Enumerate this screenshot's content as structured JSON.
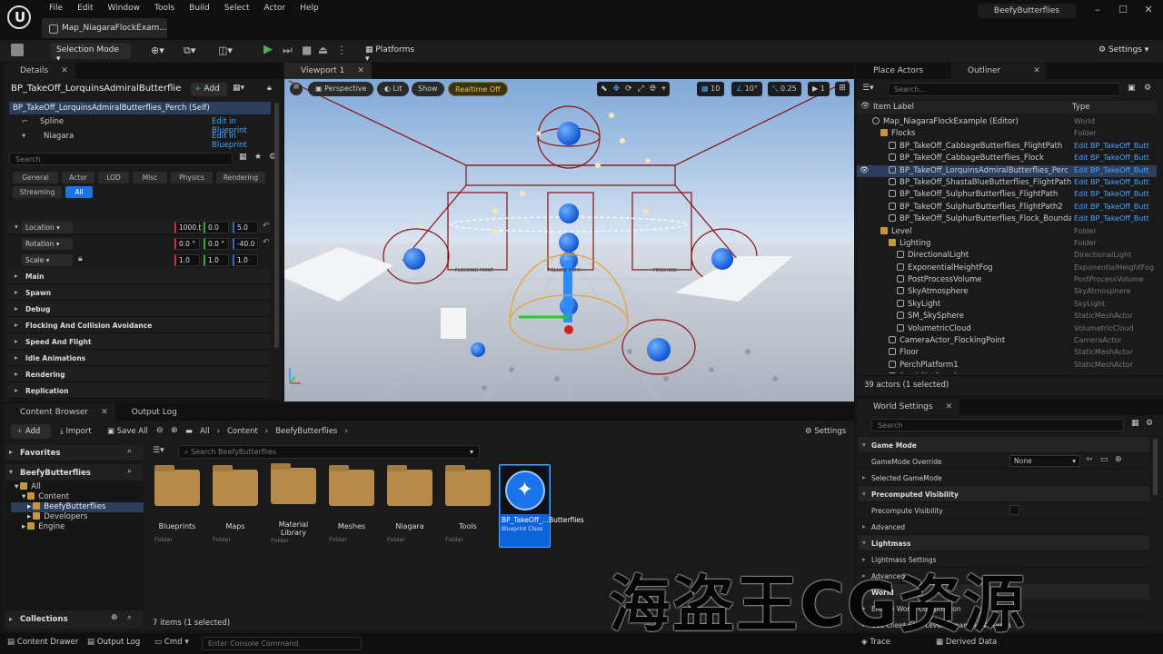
{
  "menubar": {
    "items": [
      "File",
      "Edit",
      "Window",
      "Tools",
      "Build",
      "Select",
      "Actor",
      "Help"
    ],
    "doc_tab": "Map_NiagaraFlockExam...",
    "project": "BeefyButterflies"
  },
  "toolbar": {
    "mode": "Selection Mode",
    "platforms": "Platforms",
    "settings": "Settings"
  },
  "details": {
    "tab": "Details",
    "actor_name": "BP_TakeOff_LorquinsAdmiralButterflie",
    "add": "Add",
    "components": [
      {
        "label": "BP_TakeOff_LorquinsAdmiralButterflies_Perch (Self)",
        "link": ""
      },
      {
        "label": "Spline",
        "link": "Edit in Blueprint"
      },
      {
        "label": "Niagara",
        "link": "Edit in Blueprint"
      }
    ],
    "search_placeholder": "Search",
    "categories": [
      "General",
      "Actor",
      "LOD",
      "Misc",
      "Physics",
      "Rendering",
      "Streaming",
      "All"
    ],
    "transform": {
      "title": "Transform",
      "rows": [
        {
          "label": "Location",
          "v": [
            "1000.t",
            "0.0",
            "5.0"
          ]
        },
        {
          "label": "Rotation",
          "v": [
            "0.0 °",
            "0.0 °",
            "-40.0"
          ]
        },
        {
          "label": "Scale",
          "v": [
            "1.0",
            "1.0",
            "1.0"
          ]
        }
      ]
    },
    "sections": [
      "Main",
      "Spawn",
      "Debug",
      "Flocking And Collision Avoidance",
      "Speed And Flight",
      "Idle Animations",
      "Rendering",
      "Replication"
    ]
  },
  "viewport": {
    "tab": "Viewport 1",
    "perspective": "Perspective",
    "lit": "Lit",
    "show": "Show",
    "realtime": "Realtime Off",
    "grid": "10",
    "angle": "10°",
    "scale": "0.25",
    "cam": "1",
    "labels": [
      "FLOCKING POINT",
      "FOLLOW PATH",
      "PERCHING"
    ]
  },
  "outliner": {
    "tabs": [
      "Place Actors",
      "Outliner"
    ],
    "search_placeholder": "Search...",
    "col_label": "Item Label",
    "col_type": "Type",
    "rows": [
      {
        "label": "Map_NiagaraFlockExample (Editor)",
        "type": "World",
        "indent": 1,
        "icon": "world",
        "link": false
      },
      {
        "label": "Flocks",
        "type": "Folder",
        "indent": 2,
        "icon": "folder",
        "link": false
      },
      {
        "label": "BP_TakeOff_CabbageButterflies_FlightPath",
        "type": "Edit BP_TakeOff_Butt",
        "indent": 3,
        "icon": "actor",
        "link": true
      },
      {
        "label": "BP_TakeOff_CabbageButterflies_Flock",
        "type": "Edit BP_TakeOff_Butt",
        "indent": 3,
        "icon": "actor",
        "link": true
      },
      {
        "label": "BP_TakeOff_LorquinsAdmiralButterflies_Perc",
        "type": "Edit BP_TakeOff_Butt",
        "indent": 3,
        "icon": "actor",
        "link": true,
        "selected": true
      },
      {
        "label": "BP_TakeOff_ShastaBlueButterflies_FlightPath",
        "type": "Edit BP_TakeOff_Butt",
        "indent": 3,
        "icon": "actor",
        "link": true
      },
      {
        "label": "BP_TakeOff_SulphurButterflies_FlightPath",
        "type": "Edit BP_TakeOff_Butt",
        "indent": 3,
        "icon": "actor",
        "link": true
      },
      {
        "label": "BP_TakeOff_SulphurButterflies_FlightPath2",
        "type": "Edit BP_TakeOff_Butt",
        "indent": 3,
        "icon": "actor",
        "link": true
      },
      {
        "label": "BP_TakeOff_SulphurButterflies_Flock_Bounda",
        "type": "Edit BP_TakeOff_Butt",
        "indent": 3,
        "icon": "actor",
        "link": true
      },
      {
        "label": "Level",
        "type": "Folder",
        "indent": 2,
        "icon": "folder",
        "link": false
      },
      {
        "label": "Lighting",
        "type": "Folder",
        "indent": 3,
        "icon": "folder",
        "link": false
      },
      {
        "label": "DirectionalLight",
        "type": "DirectionalLight",
        "indent": 4,
        "icon": "actor",
        "link": false
      },
      {
        "label": "ExponentialHeightFog",
        "type": "ExponentialHeightFog",
        "indent": 4,
        "icon": "actor",
        "link": false
      },
      {
        "label": "PostProcessVolume",
        "type": "PostProcessVolume",
        "indent": 4,
        "icon": "actor",
        "link": false
      },
      {
        "label": "SkyAtmosphere",
        "type": "SkyAtmosphere",
        "indent": 4,
        "icon": "actor",
        "link": false
      },
      {
        "label": "SkyLight",
        "type": "SkyLight",
        "indent": 4,
        "icon": "actor",
        "link": false
      },
      {
        "label": "SM_SkySphere",
        "type": "StaticMeshActor",
        "indent": 4,
        "icon": "actor",
        "link": false
      },
      {
        "label": "VolumetricCloud",
        "type": "VolumetricCloud",
        "indent": 4,
        "icon": "actor",
        "link": false
      },
      {
        "label": "CameraActor_FlockingPoint",
        "type": "CameraActor",
        "indent": 3,
        "icon": "actor",
        "link": false
      },
      {
        "label": "Floor",
        "type": "StaticMeshActor",
        "indent": 3,
        "icon": "actor",
        "link": false
      },
      {
        "label": "PerchPlatform1",
        "type": "StaticMeshActor",
        "indent": 3,
        "icon": "actor",
        "link": false
      },
      {
        "label": "PerchPlatform2",
        "type": "StaticMeshActor",
        "indent": 3,
        "icon": "actor",
        "link": false
      }
    ],
    "status": "39 actors (1 selected)"
  },
  "content": {
    "tabs": [
      "Content Browser",
      "Output Log"
    ],
    "add": "Add",
    "import": "Import",
    "save_all": "Save All",
    "breadcrumb": [
      "All",
      "Content",
      "BeefyButterflies"
    ],
    "settings": "Settings",
    "favorites": "Favorites",
    "project": "BeefyButterflies",
    "tree": [
      "All",
      "Content",
      "BeefyButterflies",
      "Developers",
      "Engine"
    ],
    "search_placeholder": "Search BeefyButterflies",
    "collections": "Collections",
    "assets": [
      {
        "name": "Blueprints",
        "sub": "Folder"
      },
      {
        "name": "Maps",
        "sub": "Folder"
      },
      {
        "name": "Material Library",
        "sub": "Folder"
      },
      {
        "name": "Meshes",
        "sub": "Folder"
      },
      {
        "name": "Niagara",
        "sub": "Folder"
      },
      {
        "name": "Tools",
        "sub": "Folder"
      }
    ],
    "selected_asset": {
      "name": "BP_TakeOff_...Butterflies",
      "sub": "Blueprint Class"
    },
    "count": "7 items (1 selected)"
  },
  "world_settings": {
    "tab": "World Settings",
    "search_placeholder": "Search",
    "rows": [
      {
        "t": "Game Mode",
        "h": true
      },
      {
        "t": "GameMode Override",
        "h": false,
        "value": "None"
      },
      {
        "t": "Selected GameMode",
        "h": false
      },
      {
        "t": "Precomputed Visibility",
        "h": true
      },
      {
        "t": "Precompute Visibility",
        "h": false
      },
      {
        "t": "Advanced",
        "h": false
      },
      {
        "t": "Lightmass",
        "h": true
      },
      {
        "t": "Lightmass Settings",
        "h": false
      },
      {
        "t": "Advanced",
        "h": false
      },
      {
        "t": "World",
        "h": true
      },
      {
        "t": "Enable World Composition",
        "h": false
      },
      {
        "t": "Use Client Side Level Streaming Volumes",
        "h": false
      }
    ]
  },
  "bottombar": {
    "content_drawer": "Content Drawer",
    "output_log": "Output Log",
    "cmd": "Cmd",
    "console_placeholder": "Enter Console Command",
    "trace": "Trace",
    "derived": "Derived Data"
  },
  "watermark": "海盗王CG资源"
}
